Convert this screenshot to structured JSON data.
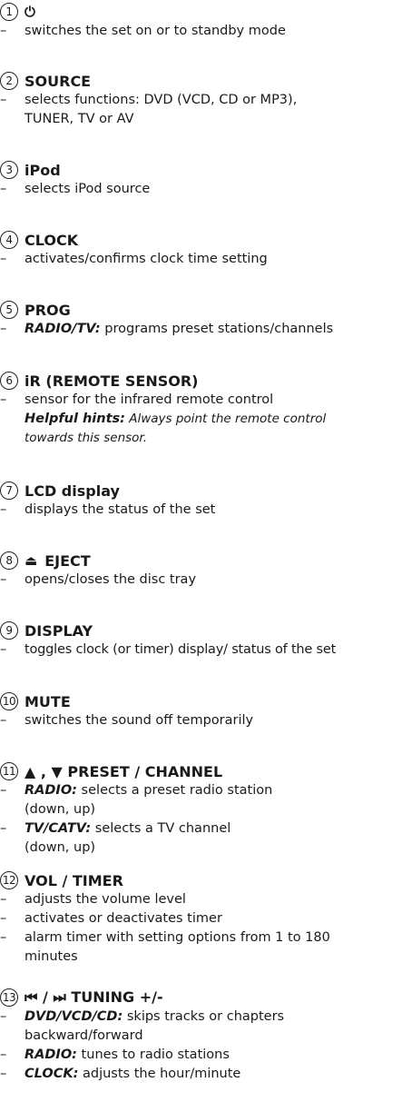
{
  "dash": "–",
  "items": [
    {
      "num": "1",
      "glyph": "⏻",
      "lines": [
        {
          "text": "switches the set on or to standby mode"
        }
      ]
    },
    {
      "num": "2",
      "title": "SOURCE",
      "lines": [
        {
          "text": "selects functions:  DVD (VCD, CD or MP3),"
        },
        {
          "cont": "TUNER,  TV or AV"
        }
      ]
    },
    {
      "num": "3",
      "title": "iPod",
      "lines": [
        {
          "text": "selects iPod source"
        }
      ]
    },
    {
      "num": "4",
      "title": "CLOCK",
      "lines": [
        {
          "text": "activates/confirms clock time setting"
        }
      ]
    },
    {
      "num": "5",
      "title": "PROG",
      "lines": [
        {
          "bold": "RADIO/TV:",
          "text": " programs preset  stations/channels"
        }
      ]
    },
    {
      "num": "6",
      "title": "iR (REMOTE SENSOR)",
      "lines": [
        {
          "text": "sensor for the infrared remote control"
        }
      ],
      "hint": {
        "label": "Helpful hints:",
        "text1": "  Always point the remote control",
        "text2": "towards this sensor."
      }
    },
    {
      "num": "7",
      "title": "LCD display",
      "lines": [
        {
          "text": "displays the status of the set"
        }
      ]
    },
    {
      "num": "8",
      "glyph": "⏏",
      "title": "EJECT",
      "lines": [
        {
          "text": "opens/closes the disc tray"
        }
      ]
    },
    {
      "num": "9",
      "title": "DISPLAY",
      "lines": [
        {
          "text": "toggles clock (or timer) display/ status of the set"
        }
      ]
    },
    {
      "num": "10",
      "title": "MUTE",
      "lines": [
        {
          "text": "switches the sound off temporarily"
        }
      ]
    },
    {
      "num": "11",
      "title": "▲ , ▼  PRESET / CHANNEL",
      "lines": [
        {
          "bold": "RADIO:",
          "text": " selects a preset radio station"
        },
        {
          "cont": " (down, up)"
        },
        {
          "bold": "TV/CATV:",
          "text": " selects a TV channel"
        },
        {
          "cont": " (down, up)"
        }
      ]
    },
    {
      "num": "12",
      "title": "VOL / TIMER",
      "lines": [
        {
          "text": "adjusts the volume level"
        },
        {
          "text": "activates or deactivates timer"
        },
        {
          "text": "alarm timer with setting options from 1 to 180"
        },
        {
          "cont": "minutes"
        }
      ]
    },
    {
      "num": "13",
      "title": "⏮ / ⏭ TUNING +/-",
      "lines": [
        {
          "bold": " DVD/VCD/CD:",
          "text": "  skips tracks or chapters"
        },
        {
          "cont": "backward/forward"
        },
        {
          "bold": "RADIO:",
          "text": " tunes to radio stations"
        },
        {
          "bold": "CLOCK:",
          "text": " adjusts the hour/minute"
        }
      ]
    }
  ]
}
